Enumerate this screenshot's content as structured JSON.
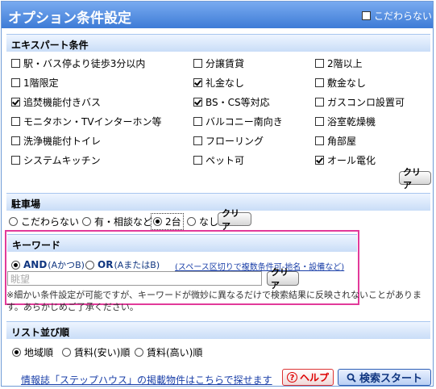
{
  "title": "オプション条件設定",
  "no_preference": {
    "label": "こだわらない",
    "checked": false
  },
  "expert": {
    "heading": "エキスパート条件",
    "items": [
      {
        "label": "駅・バス停より徒歩3分以内",
        "checked": false
      },
      {
        "label": "分譲賃貸",
        "checked": false
      },
      {
        "label": "2階以上",
        "checked": false
      },
      {
        "label": "1階限定",
        "checked": false
      },
      {
        "label": "礼金なし",
        "checked": true
      },
      {
        "label": "敷金なし",
        "checked": false
      },
      {
        "label": "追焚機能付きバス",
        "checked": true
      },
      {
        "label": "BS・CS等対応",
        "checked": true
      },
      {
        "label": "ガスコンロ設置可",
        "checked": false
      },
      {
        "label": "モニタホン・TVインターホン等",
        "checked": false
      },
      {
        "label": "バルコニー南向き",
        "checked": false
      },
      {
        "label": "浴室乾燥機",
        "checked": false
      },
      {
        "label": "洗浄機能付トイレ",
        "checked": false
      },
      {
        "label": "フローリング",
        "checked": false
      },
      {
        "label": "角部屋",
        "checked": false
      },
      {
        "label": "システムキッチン",
        "checked": false
      },
      {
        "label": "ペット可",
        "checked": false
      },
      {
        "label": "オール電化",
        "checked": true
      }
    ],
    "clear_label": "クリア"
  },
  "parking": {
    "heading": "駐車場",
    "options": [
      {
        "label": "こだわらない",
        "selected": false
      },
      {
        "label": "有・相談など",
        "selected": false
      },
      {
        "label": "2台",
        "selected": true
      },
      {
        "label": "なし",
        "selected": false
      }
    ],
    "clear_label": "クリア"
  },
  "keyword": {
    "heading": "キーワード",
    "and_label": "AND",
    "and_sub": "(AかつB)",
    "or_label": "OR",
    "or_sub": "(AまたはB)",
    "mode": "AND",
    "hint": "(スペース区切りで複数条件可-地名・設備など)",
    "value": "眺望",
    "clear_label": "クリア",
    "note": "※細かい条件設定が可能ですが、キーワードが微妙に異なるだけで検索結果に反映されないことがあります。あらかじめご了承ください。"
  },
  "sort": {
    "heading": "リスト並び順",
    "options": [
      {
        "label": "地域順",
        "selected": true
      },
      {
        "label": "賃料(安い)順",
        "selected": false
      },
      {
        "label": "賃料(高い)順",
        "selected": false
      }
    ]
  },
  "footer": {
    "link_text": "情報誌「ステップハウス」の掲載物件はこちらで探せます",
    "help_label": "ヘルプ",
    "search_label": "検索スタート"
  },
  "colors": {
    "title_bar": "#3d7bd6",
    "highlight": "#e23a9a",
    "link": "#1a3fa8"
  }
}
